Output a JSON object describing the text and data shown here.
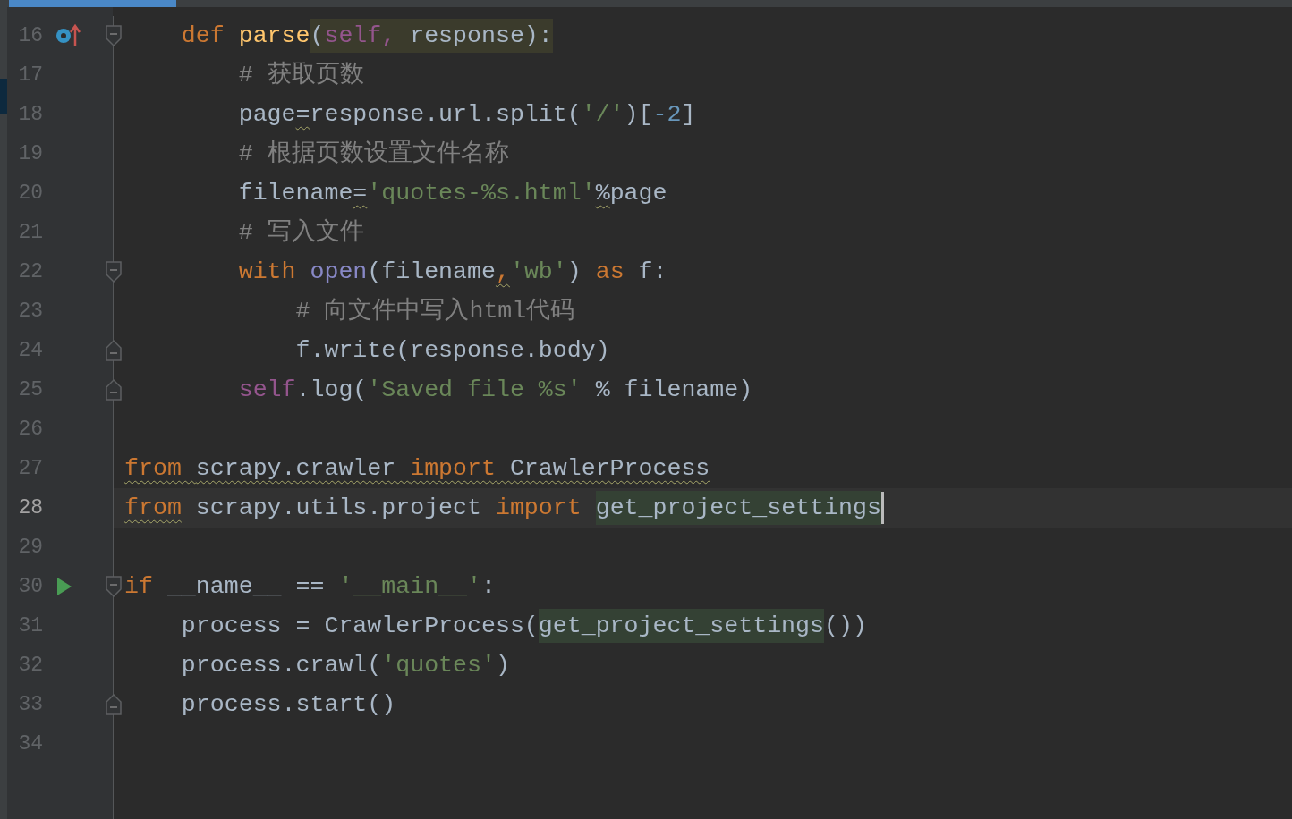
{
  "lines": [
    {
      "number": "16",
      "current": false,
      "gutter_icon": {
        "kind": "override"
      },
      "fold": {
        "kind": "start"
      },
      "tokens": [
        {
          "t": "    def ",
          "kind": "keyword"
        },
        {
          "t": "parse",
          "kind": "function"
        },
        {
          "t": "(",
          "kind": "plain",
          "match": true
        },
        {
          "t": "self, ",
          "kind": "self",
          "match": true
        },
        {
          "t": "response):",
          "kind": "plain",
          "match": true
        }
      ]
    },
    {
      "number": "17",
      "current": false,
      "tokens": [
        {
          "t": "        # 获取页数",
          "kind": "comment"
        }
      ]
    },
    {
      "number": "18",
      "current": false,
      "tokens": [
        {
          "t": "        page",
          "kind": "plain"
        },
        {
          "t": "=",
          "kind": "plain",
          "warn": true
        },
        {
          "t": "response.url.split(",
          "kind": "plain"
        },
        {
          "t": "'/'",
          "kind": "string"
        },
        {
          "t": ")[",
          "kind": "plain"
        },
        {
          "t": "-2",
          "kind": "number"
        },
        {
          "t": "]",
          "kind": "plain"
        }
      ]
    },
    {
      "number": "19",
      "current": false,
      "tokens": [
        {
          "t": "        # 根据页数设置文件名称",
          "kind": "comment"
        }
      ]
    },
    {
      "number": "20",
      "current": false,
      "tokens": [
        {
          "t": "        filename",
          "kind": "plain"
        },
        {
          "t": "=",
          "kind": "plain",
          "warn": true
        },
        {
          "t": "'quotes-%s.html'",
          "kind": "string"
        },
        {
          "t": "%",
          "kind": "plain",
          "warn": true
        },
        {
          "t": "page",
          "kind": "plain"
        }
      ]
    },
    {
      "number": "21",
      "current": false,
      "tokens": [
        {
          "t": "        # 写入文件",
          "kind": "comment"
        }
      ]
    },
    {
      "number": "22",
      "current": false,
      "fold": {
        "kind": "start"
      },
      "tokens": [
        {
          "t": "        with ",
          "kind": "keyword"
        },
        {
          "t": "open",
          "kind": "builtin"
        },
        {
          "t": "(filename",
          "kind": "plain"
        },
        {
          "t": ",",
          "kind": "keyword",
          "warn": true
        },
        {
          "t": "'wb'",
          "kind": "string"
        },
        {
          "t": ") ",
          "kind": "plain"
        },
        {
          "t": "as ",
          "kind": "keyword"
        },
        {
          "t": "f:",
          "kind": "plain"
        }
      ]
    },
    {
      "number": "23",
      "current": false,
      "tokens": [
        {
          "t": "            # 向文件中写入html代码",
          "kind": "comment"
        }
      ]
    },
    {
      "number": "24",
      "current": false,
      "fold": {
        "kind": "end"
      },
      "tokens": [
        {
          "t": "            f.write(response.body)",
          "kind": "plain"
        }
      ]
    },
    {
      "number": "25",
      "current": false,
      "fold": {
        "kind": "end"
      },
      "tokens": [
        {
          "t": "        self",
          "kind": "self"
        },
        {
          "t": ".log(",
          "kind": "plain"
        },
        {
          "t": "'Saved file %s'",
          "kind": "string"
        },
        {
          "t": " % filename)",
          "kind": "plain"
        }
      ]
    },
    {
      "number": "26",
      "current": false
    },
    {
      "number": "27",
      "current": false,
      "tokens": [
        {
          "t": "from ",
          "kind": "keyword",
          "warn": true
        },
        {
          "t": "scrapy.crawler ",
          "kind": "plain",
          "warn": true
        },
        {
          "t": "import ",
          "kind": "keyword",
          "warn": true
        },
        {
          "t": "CrawlerProcess",
          "kind": "plain",
          "warn": true
        }
      ]
    },
    {
      "number": "28",
      "current": true,
      "cursor": true,
      "tokens": [
        {
          "t": "from",
          "kind": "keyword",
          "warn": true
        },
        {
          "t": " scrapy.utils.project ",
          "kind": "plain"
        },
        {
          "t": "import ",
          "kind": "keyword"
        },
        {
          "t": "get_project_settings",
          "kind": "plain",
          "usage": true
        }
      ]
    },
    {
      "number": "29",
      "current": false
    },
    {
      "number": "30",
      "current": false,
      "gutter_icon": {
        "kind": "run"
      },
      "fold": {
        "kind": "start"
      },
      "tokens": [
        {
          "t": "if ",
          "kind": "keyword"
        },
        {
          "t": "__name__ == ",
          "kind": "plain"
        },
        {
          "t": "'__main__'",
          "kind": "string"
        },
        {
          "t": ":",
          "kind": "plain"
        }
      ]
    },
    {
      "number": "31",
      "current": false,
      "tokens": [
        {
          "t": "    process = CrawlerProcess(",
          "kind": "plain"
        },
        {
          "t": "get_project_settings",
          "kind": "plain",
          "usage": true
        },
        {
          "t": "())",
          "kind": "plain"
        }
      ]
    },
    {
      "number": "32",
      "current": false,
      "tokens": [
        {
          "t": "    process.crawl(",
          "kind": "plain"
        },
        {
          "t": "'quotes'",
          "kind": "string"
        },
        {
          "t": ")",
          "kind": "plain"
        }
      ]
    },
    {
      "number": "33",
      "current": false,
      "fold": {
        "kind": "end"
      },
      "tokens": [
        {
          "t": "    process.start()",
          "kind": "plain"
        }
      ]
    },
    {
      "number": "34",
      "current": false
    }
  ]
}
